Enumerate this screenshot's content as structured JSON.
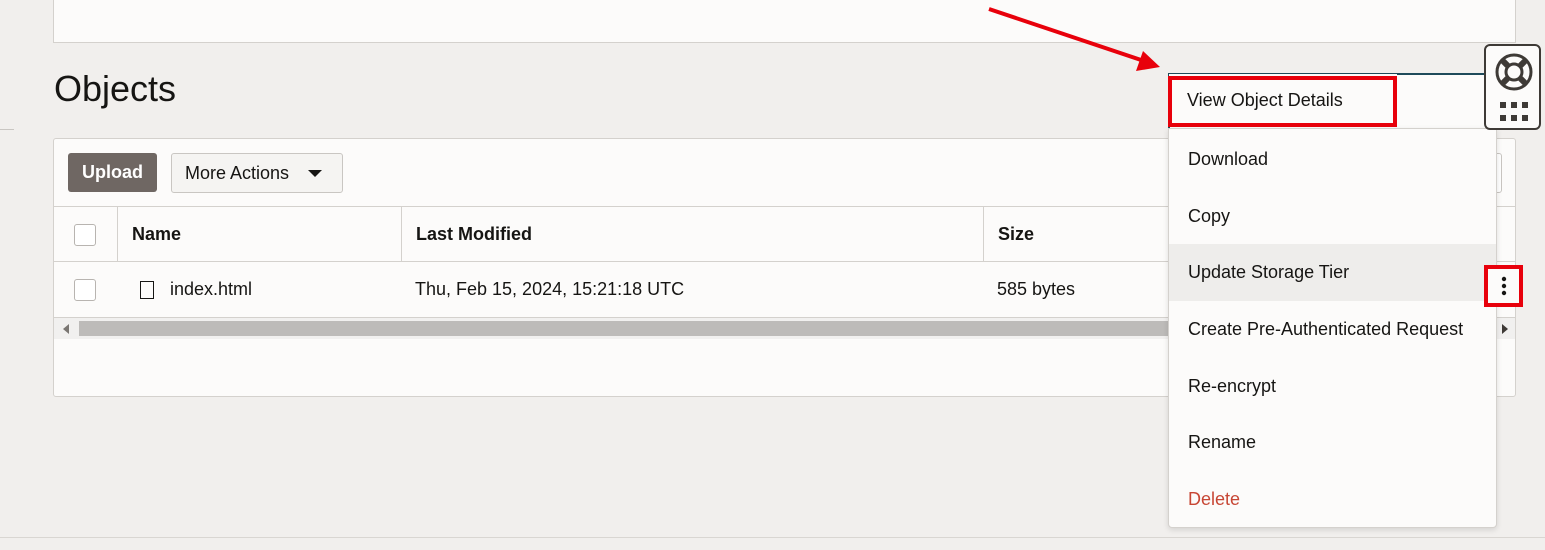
{
  "page": {
    "title": "Objects"
  },
  "toolbar": {
    "upload_label": "Upload",
    "more_actions_label": "More Actions"
  },
  "table": {
    "columns": [
      "Name",
      "Last Modified",
      "Size"
    ],
    "rows": [
      {
        "name": "index.html",
        "last_modified": "Thu, Feb 15, 2024, 15:21:18 UTC",
        "size": "585 bytes"
      }
    ]
  },
  "context_menu": {
    "items": [
      {
        "label": "View Object Details"
      },
      {
        "label": "Download"
      },
      {
        "label": "Copy"
      },
      {
        "label": "Update Storage Tier"
      },
      {
        "label": "Create Pre-Authenticated Request"
      },
      {
        "label": "Re-encrypt"
      },
      {
        "label": "Rename"
      },
      {
        "label": "Delete"
      }
    ]
  },
  "icons": {
    "file": "file-icon",
    "kebab": "more-vertical-icon",
    "help": "lifebuoy-icon",
    "apps": "grid-icon",
    "dropdown": "caret-down-icon"
  },
  "colors": {
    "accent_primary_button": "#6f6763",
    "danger": "#c74634",
    "annotation": "#e8000b",
    "menu_anchor_border": "#1e4a5a"
  }
}
